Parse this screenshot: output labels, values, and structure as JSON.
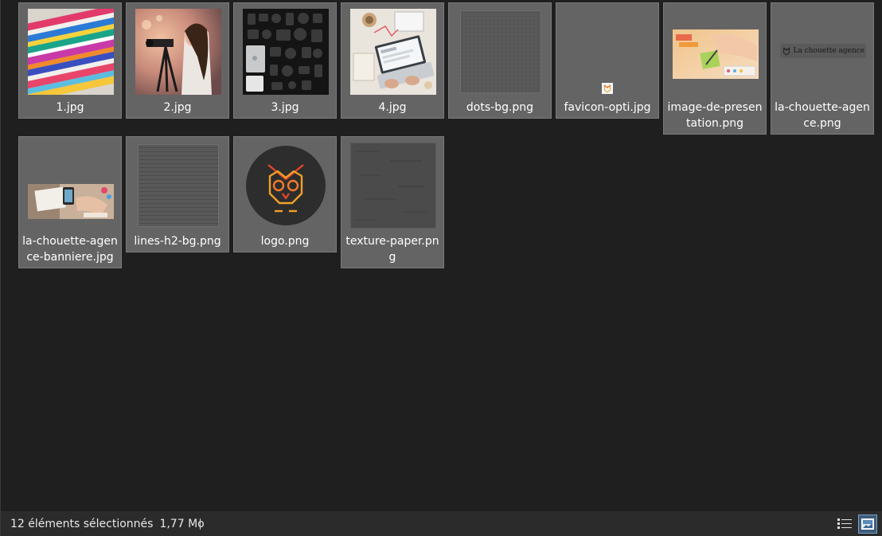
{
  "files": [
    {
      "name": "1.jpg",
      "thumb": "magazines"
    },
    {
      "name": "2.jpg",
      "thumb": "photographer"
    },
    {
      "name": "3.jpg",
      "thumb": "gear-flatlay"
    },
    {
      "name": "4.jpg",
      "thumb": "laptop-desk"
    },
    {
      "name": "dots-bg.png",
      "thumb": "dots"
    },
    {
      "name": "favicon-opti.jpg",
      "thumb": "favicon"
    },
    {
      "name": "image-de-presentation.png",
      "thumb": "presentation"
    },
    {
      "name": "la-chouette-agence.png",
      "thumb": "wordmark",
      "thumb_text": "La chouette agence"
    },
    {
      "name": "la-chouette-agence-banniere.jpg",
      "thumb": "banner"
    },
    {
      "name": "lines-h2-bg.png",
      "thumb": "lines"
    },
    {
      "name": "logo.png",
      "thumb": "owl-logo"
    },
    {
      "name": "texture-paper.png",
      "thumb": "paper"
    }
  ],
  "status": {
    "selection": "12 éléments sélectionnés",
    "size": "1,77 Mo"
  },
  "view_buttons": [
    {
      "name": "details-view",
      "icon": "details-view-icon"
    },
    {
      "name": "large-icons-view",
      "icon": "large-icons-view-icon",
      "active": true
    }
  ],
  "colors": {
    "background": "#1f1f1f",
    "selected_tile": "#646464",
    "statusbar": "#2b2b2b",
    "owl_orange": "#f0a028",
    "owl_red": "#e0452a"
  }
}
